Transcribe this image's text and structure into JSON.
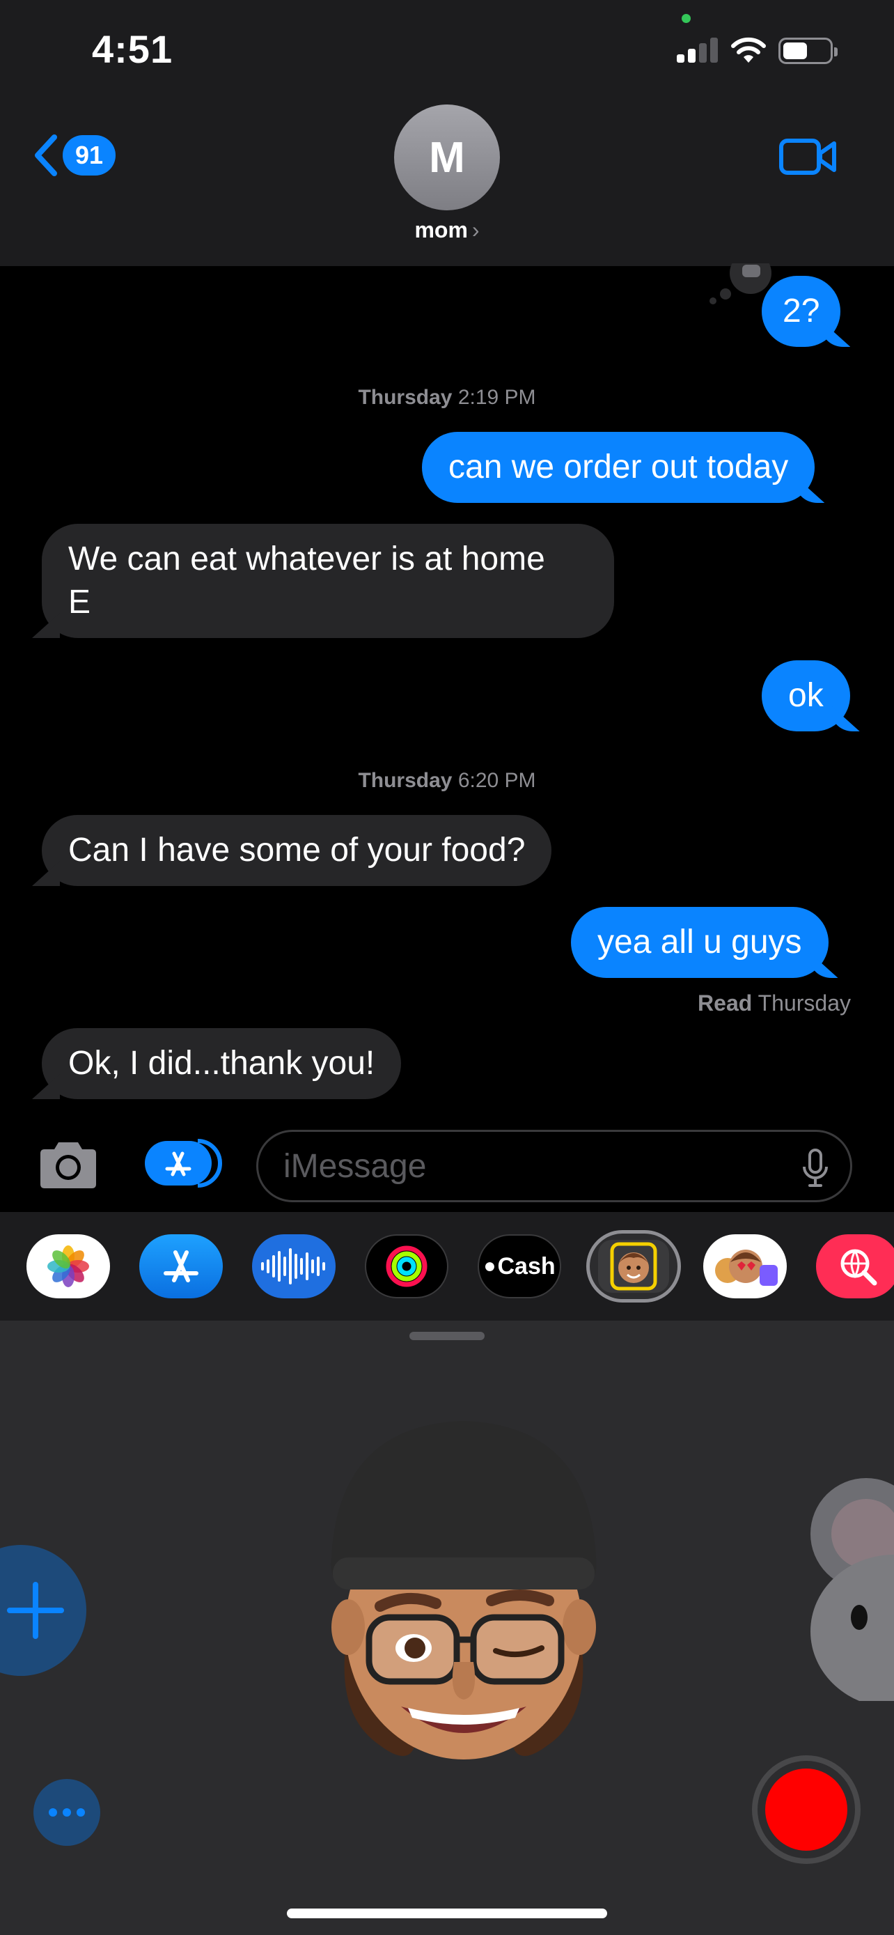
{
  "status_bar": {
    "time": "4:51"
  },
  "header": {
    "back_count": "91",
    "avatar_initial": "M",
    "contact_name": "mom"
  },
  "conversation": {
    "partial_top_message": "2?",
    "timestamps": [
      {
        "day": "Thursday",
        "time": "2:19 PM"
      },
      {
        "day": "Thursday",
        "time": "6:20 PM"
      }
    ],
    "messages": [
      {
        "direction": "sent",
        "text": "can we order out today"
      },
      {
        "direction": "received",
        "lines": [
          "We can eat whatever is at home",
          "E"
        ]
      },
      {
        "direction": "sent",
        "text": "ok"
      },
      {
        "direction": "received",
        "text": "Can I have some of your food?"
      },
      {
        "direction": "sent",
        "text": "yea all u guys"
      },
      {
        "direction": "received",
        "text": "Ok, I did...thank you!"
      }
    ],
    "read_receipt": {
      "label": "Read",
      "when": "Thursday"
    }
  },
  "input": {
    "placeholder": "iMessage"
  },
  "app_drawer": {
    "apps": [
      {
        "icon": "photos-icon"
      },
      {
        "icon": "app-store-icon"
      },
      {
        "icon": "audio-message-icon"
      },
      {
        "icon": "activity-icon"
      },
      {
        "icon": "apple-cash-icon",
        "label": "Cash"
      },
      {
        "icon": "memoji-icon",
        "selected": true
      },
      {
        "icon": "memoji-stickers-icon"
      },
      {
        "icon": "web-search-icon"
      }
    ],
    "colors": {
      "accent": "#0a84ff",
      "record": "#ff0000",
      "received_bubble": "#262628"
    }
  }
}
